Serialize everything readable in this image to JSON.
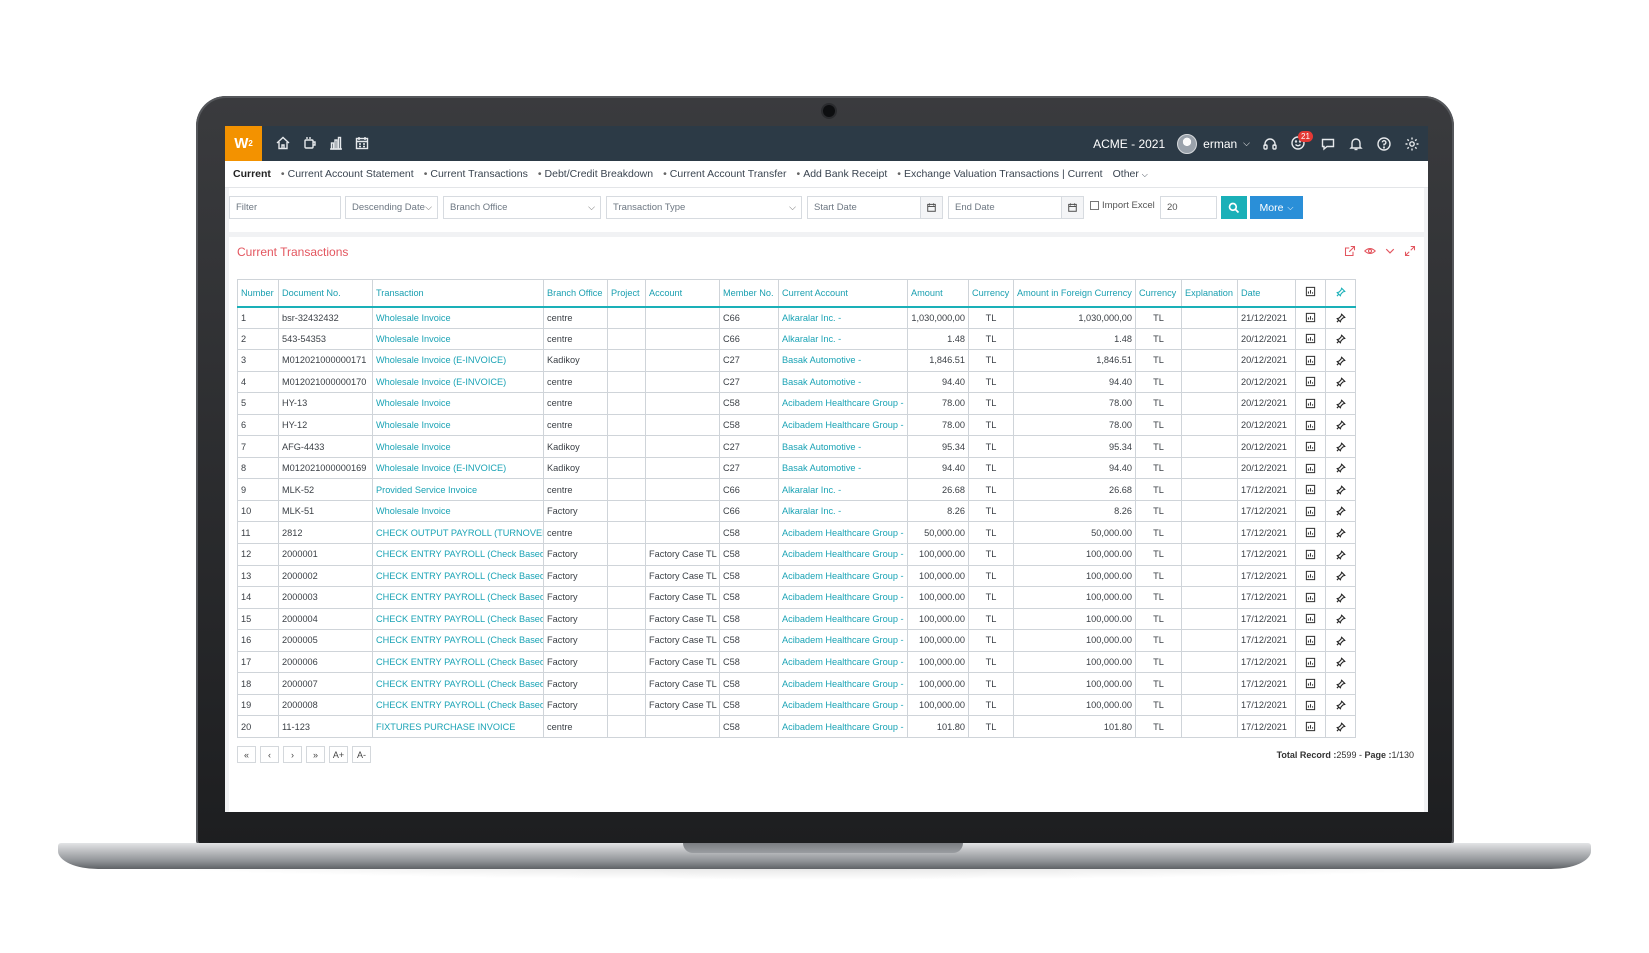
{
  "app": {
    "logo_text": "W",
    "logo_sup": "2",
    "company": "ACME - 2021",
    "user": "erman",
    "notification_count": "21",
    "colors": {
      "topbar": "#2c3a46",
      "logo": "#f39200",
      "accent": "#1ab0b8",
      "more": "#2a8fd8",
      "title": "#e3565f"
    }
  },
  "topbar_icons": [
    "home-icon",
    "mug-icon",
    "bar-chart-icon",
    "calendar-icon"
  ],
  "subnav": {
    "active": "Current",
    "items": [
      "Current Account Statement",
      "Current Transactions",
      "Debt/Credit Breakdown",
      "Current Account Transfer",
      "Add Bank Receipt",
      "Exchange Valuation Transactions | Current"
    ],
    "other": "Other"
  },
  "filters": {
    "filter_placeholder": "Filter",
    "sort": "Descending Date",
    "branch": "Branch Office",
    "transaction_type": "Transaction Type",
    "start_date": "Start Date",
    "end_date": "End Date",
    "import_excel": "Import Excel",
    "page_size": "20",
    "more": "More"
  },
  "panel": {
    "title": "Current Transactions"
  },
  "table": {
    "headers": [
      "Number",
      "Document No.",
      "Transaction",
      "Branch Office",
      "Project",
      "Account",
      "Member No.",
      "Current Account",
      "Amount",
      "Currency",
      "Amount in Foreign Currency",
      "Currency",
      "Explanation",
      "Date"
    ],
    "rows": [
      [
        "1",
        "bsr-32432432",
        "Wholesale Invoice",
        "centre",
        "",
        "",
        "C66",
        "Alkaralar Inc. -",
        "1,030,000,00",
        "TL",
        "1,030,000,00",
        "TL",
        "",
        "21/12/2021"
      ],
      [
        "2",
        "543-54353",
        "Wholesale Invoice",
        "centre",
        "",
        "",
        "C66",
        "Alkaralar Inc. -",
        "1.48",
        "TL",
        "1.48",
        "TL",
        "",
        "20/12/2021"
      ],
      [
        "3",
        "M012021000000171",
        "Wholesale Invoice (E-INVOICE)",
        "Kadikoy",
        "",
        "",
        "C27",
        "Basak Automotive -",
        "1,846.51",
        "TL",
        "1,846.51",
        "TL",
        "",
        "20/12/2021"
      ],
      [
        "4",
        "M012021000000170",
        "Wholesale Invoice (E-INVOICE)",
        "centre",
        "",
        "",
        "C27",
        "Basak Automotive -",
        "94.40",
        "TL",
        "94.40",
        "TL",
        "",
        "20/12/2021"
      ],
      [
        "5",
        "HY-13",
        "Wholesale Invoice",
        "centre",
        "",
        "",
        "C58",
        "Acibadem Healthcare Group -",
        "78.00",
        "TL",
        "78.00",
        "TL",
        "",
        "20/12/2021"
      ],
      [
        "6",
        "HY-12",
        "Wholesale Invoice",
        "centre",
        "",
        "",
        "C58",
        "Acibadem Healthcare Group -",
        "78.00",
        "TL",
        "78.00",
        "TL",
        "",
        "20/12/2021"
      ],
      [
        "7",
        "AFG-4433",
        "Wholesale Invoice",
        "Kadikoy",
        "",
        "",
        "C27",
        "Basak Automotive -",
        "95.34",
        "TL",
        "95.34",
        "TL",
        "",
        "20/12/2021"
      ],
      [
        "8",
        "M012021000000169",
        "Wholesale Invoice (E-INVOICE)",
        "Kadikoy",
        "",
        "",
        "C27",
        "Basak Automotive -",
        "94.40",
        "TL",
        "94.40",
        "TL",
        "",
        "20/12/2021"
      ],
      [
        "9",
        "MLK-52",
        "Provided Service Invoice",
        "centre",
        "",
        "",
        "C66",
        "Alkaralar Inc. -",
        "26.68",
        "TL",
        "26.68",
        "TL",
        "",
        "17/12/2021"
      ],
      [
        "10",
        "MLK-51",
        "Wholesale Invoice",
        "Factory",
        "",
        "",
        "C66",
        "Alkaralar Inc. -",
        "8.26",
        "TL",
        "8.26",
        "TL",
        "",
        "17/12/2021"
      ],
      [
        "11",
        "2812",
        "CHECK OUTPUT PAYROLL (TURNOVER)",
        "centre",
        "",
        "",
        "C58",
        "Acibadem Healthcare Group -",
        "50,000.00",
        "TL",
        "50,000.00",
        "TL",
        "",
        "17/12/2021"
      ],
      [
        "12",
        "2000001",
        "CHECK ENTRY PAYROLL (Check Based)",
        "Factory",
        "",
        "Factory Case TL",
        "C58",
        "Acibadem Healthcare Group -",
        "100,000.00",
        "TL",
        "100,000.00",
        "TL",
        "",
        "17/12/2021"
      ],
      [
        "13",
        "2000002",
        "CHECK ENTRY PAYROLL (Check Based)",
        "Factory",
        "",
        "Factory Case TL",
        "C58",
        "Acibadem Healthcare Group -",
        "100,000.00",
        "TL",
        "100,000.00",
        "TL",
        "",
        "17/12/2021"
      ],
      [
        "14",
        "2000003",
        "CHECK ENTRY PAYROLL (Check Based)",
        "Factory",
        "",
        "Factory Case TL",
        "C58",
        "Acibadem Healthcare Group -",
        "100,000.00",
        "TL",
        "100,000.00",
        "TL",
        "",
        "17/12/2021"
      ],
      [
        "15",
        "2000004",
        "CHECK ENTRY PAYROLL (Check Based)",
        "Factory",
        "",
        "Factory Case TL",
        "C58",
        "Acibadem Healthcare Group -",
        "100,000.00",
        "TL",
        "100,000.00",
        "TL",
        "",
        "17/12/2021"
      ],
      [
        "16",
        "2000005",
        "CHECK ENTRY PAYROLL (Check Based)",
        "Factory",
        "",
        "Factory Case TL",
        "C58",
        "Acibadem Healthcare Group -",
        "100,000.00",
        "TL",
        "100,000.00",
        "TL",
        "",
        "17/12/2021"
      ],
      [
        "17",
        "2000006",
        "CHECK ENTRY PAYROLL (Check Based)",
        "Factory",
        "",
        "Factory Case TL",
        "C58",
        "Acibadem Healthcare Group -",
        "100,000.00",
        "TL",
        "100,000.00",
        "TL",
        "",
        "17/12/2021"
      ],
      [
        "18",
        "2000007",
        "CHECK ENTRY PAYROLL (Check Based)",
        "Factory",
        "",
        "Factory Case TL",
        "C58",
        "Acibadem Healthcare Group -",
        "100,000.00",
        "TL",
        "100,000.00",
        "TL",
        "",
        "17/12/2021"
      ],
      [
        "19",
        "2000008",
        "CHECK ENTRY PAYROLL (Check Based)",
        "Factory",
        "",
        "Factory Case TL",
        "C58",
        "Acibadem Healthcare Group -",
        "100,000.00",
        "TL",
        "100,000.00",
        "TL",
        "",
        "17/12/2021"
      ],
      [
        "20",
        "11-123",
        "FIXTURES PURCHASE INVOICE",
        "centre",
        "",
        "",
        "C58",
        "Acibadem Healthcare Group -",
        "101.80",
        "TL",
        "101.80",
        "TL",
        "",
        "17/12/2021"
      ]
    ]
  },
  "pager": {
    "buttons": [
      "«",
      "‹",
      "›",
      "»",
      "A+",
      "A-"
    ],
    "total_label": "Total Record :",
    "total_value": "2599",
    "separator": " - ",
    "page_label": "Page :",
    "page_value": "1/130"
  }
}
